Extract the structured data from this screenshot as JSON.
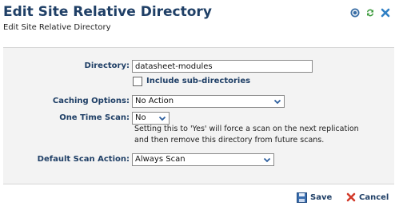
{
  "header": {
    "title": "Edit Site Relative Directory",
    "subtitle": "Edit Site Relative Directory",
    "icons": [
      "help-icon",
      "refresh-icon",
      "close-icon"
    ]
  },
  "form": {
    "directory_label": "Directory:",
    "directory_value": "datasheet-modules",
    "include_sub_label": "Include sub-directories",
    "caching_label": "Caching Options:",
    "caching_value": "No Action",
    "one_time_label": "One Time Scan:",
    "one_time_value": "No",
    "one_time_help_1": "Setting this to 'Yes' will force a scan on the next replication",
    "one_time_help_2": "and then remove this directory from future scans.",
    "default_scan_label": "Default Scan Action:",
    "default_scan_value": "Always Scan"
  },
  "footer": {
    "save_label": "Save",
    "cancel_label": "Cancel"
  },
  "colors": {
    "title": "#1f3f66",
    "panel_bg": "#f3f3f3",
    "label": "#1f3f66"
  }
}
